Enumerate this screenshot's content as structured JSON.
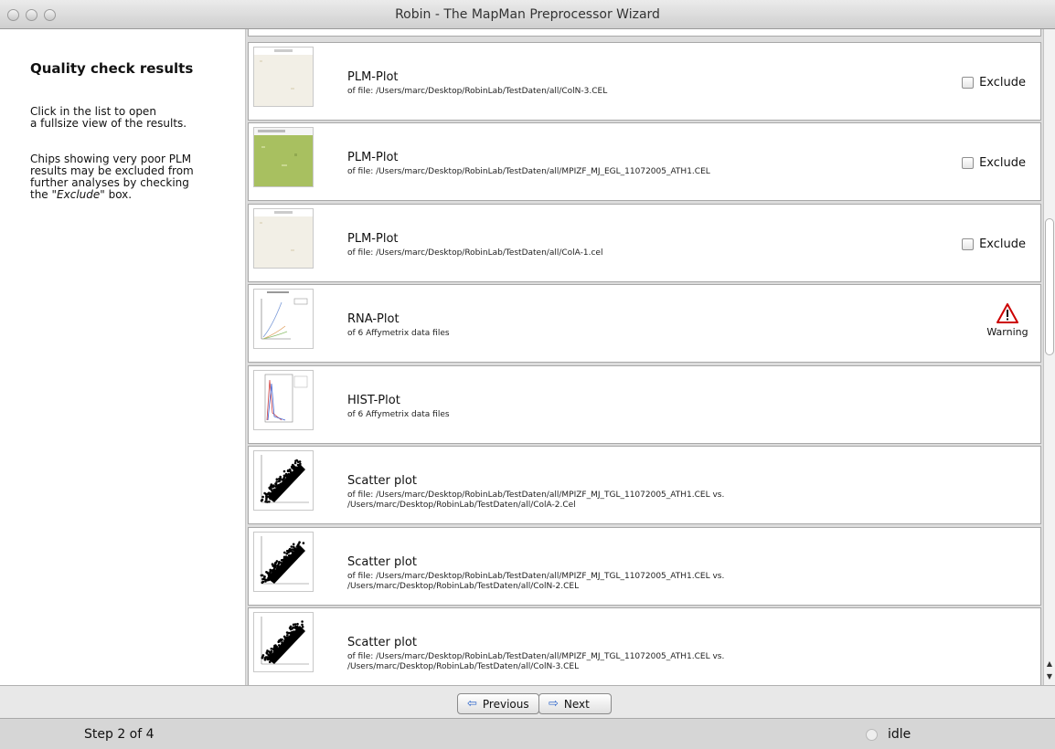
{
  "window": {
    "title": "Robin - The MapMan Preprocessor Wizard"
  },
  "left_panel": {
    "heading": "Quality check results",
    "para1": "Click in the list to open\na fullsize view of the results.",
    "para2_text": "Chips showing very poor PLM\nresults may be excluded from\nfurther analyses by checking\nthe ",
    "para2_em": "\"Exclude\"",
    "para2_end": " box."
  },
  "rows": [
    {
      "title": "PLM-Plot",
      "subtitle": "of file: /Users/marc/Desktop/RobinLab/TestDaten/all/ColN-3.CEL",
      "action": "exclude",
      "action_label": "Exclude",
      "thumb": "plm-beige"
    },
    {
      "title": "PLM-Plot",
      "subtitle": "of file: /Users/marc/Desktop/RobinLab/TestDaten/all/MPIZF_MJ_EGL_11072005_ATH1.CEL",
      "action": "exclude",
      "action_label": "Exclude",
      "thumb": "plm-green"
    },
    {
      "title": "PLM-Plot",
      "subtitle": "of file: /Users/marc/Desktop/RobinLab/TestDaten/all/ColA-1.cel",
      "action": "exclude",
      "action_label": "Exclude",
      "thumb": "plm-beige"
    },
    {
      "title": "RNA-Plot",
      "subtitle": "of 6 Affymetrix data files",
      "action": "warning",
      "action_label": "Warning",
      "thumb": "rna"
    },
    {
      "title": "HIST-Plot",
      "subtitle": "of 6 Affymetrix data files",
      "action": "none",
      "action_label": "",
      "thumb": "hist"
    },
    {
      "title": "Scatter plot",
      "subtitle": "of file: /Users/marc/Desktop/RobinLab/TestDaten/all/MPIZF_MJ_TGL_11072005_ATH1.CEL vs.",
      "subtitle2": "/Users/marc/Desktop/RobinLab/TestDaten/all/ColA-2.Cel",
      "action": "none",
      "action_label": "",
      "thumb": "scatter"
    },
    {
      "title": "Scatter plot",
      "subtitle": "of file: /Users/marc/Desktop/RobinLab/TestDaten/all/MPIZF_MJ_TGL_11072005_ATH1.CEL vs.",
      "subtitle2": "/Users/marc/Desktop/RobinLab/TestDaten/all/ColN-2.CEL",
      "action": "none",
      "action_label": "",
      "thumb": "scatter"
    },
    {
      "title": "Scatter plot",
      "subtitle": "of file: /Users/marc/Desktop/RobinLab/TestDaten/all/MPIZF_MJ_TGL_11072005_ATH1.CEL vs.",
      "subtitle2": "/Users/marc/Desktop/RobinLab/TestDaten/all/ColN-3.CEL",
      "action": "none",
      "action_label": "",
      "thumb": "scatter"
    }
  ],
  "nav": {
    "previous_label": "Previous",
    "next_label": "Next",
    "previous_icon": "arrow-left-icon",
    "next_icon": "arrow-right-icon"
  },
  "status": {
    "step": "Step 2 of 4",
    "state": "idle"
  },
  "colors": {
    "warning": "#cc0000",
    "button_icon": "#2b64c9",
    "plm_green": "#a8c060",
    "plm_beige": "#f2efe6"
  }
}
